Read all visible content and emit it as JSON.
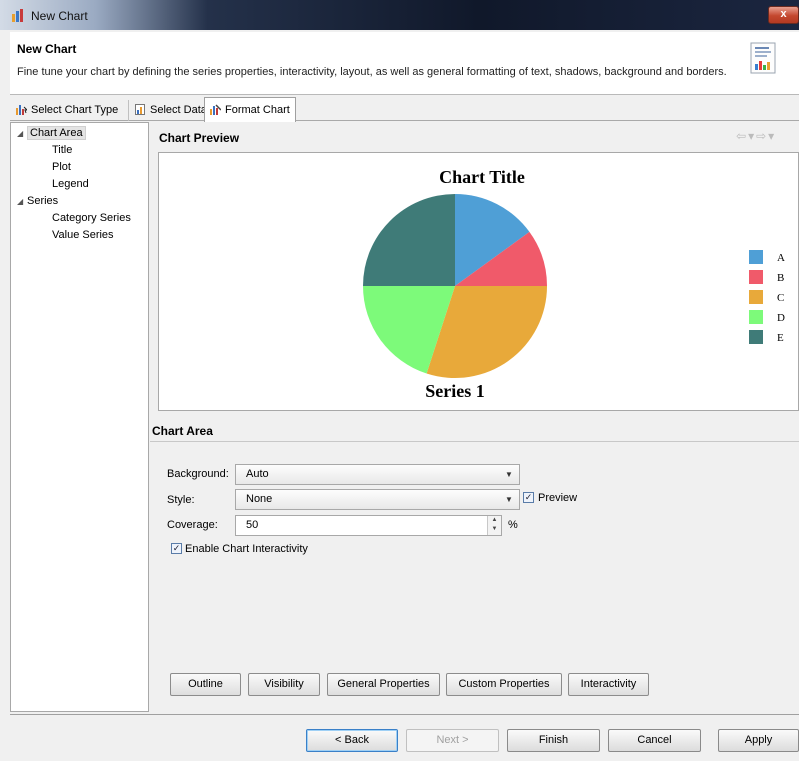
{
  "window": {
    "title": "New Chart",
    "close_label": "x"
  },
  "header": {
    "title": "New Chart",
    "description": "Fine tune your chart by defining the series properties, interactivity, layout, as well as general formatting of text, shadows, background and borders."
  },
  "tabs": [
    {
      "label": "Select Chart Type"
    },
    {
      "label": "Select Data"
    },
    {
      "label": "Format Chart",
      "active": true
    }
  ],
  "tree": {
    "chart_area": "Chart Area",
    "title": "Title",
    "plot": "Plot",
    "legend": "Legend",
    "series": "Series",
    "category_series": "Category Series",
    "value_series": "Value Series"
  },
  "preview": {
    "title": "Chart Preview"
  },
  "chart_data": {
    "type": "pie",
    "title": "Chart Title",
    "xlabel": "Series 1",
    "categories": [
      "A",
      "B",
      "C",
      "D",
      "E"
    ],
    "values": [
      15,
      10,
      30,
      20,
      25
    ],
    "colors": [
      "#4f9fd6",
      "#f05a6a",
      "#e8a93a",
      "#7dfa7a",
      "#3f7b78"
    ],
    "legend_position": "right"
  },
  "chart_area": {
    "title": "Chart Area",
    "background_label": "Background:",
    "background_value": "Auto",
    "style_label": "Style:",
    "style_value": "None",
    "preview_label": "Preview",
    "coverage_label": "Coverage:",
    "coverage_value": "50",
    "coverage_unit": "%",
    "interactivity_label": "Enable Chart Interactivity",
    "preview_checked": true,
    "interactivity_checked": true
  },
  "property_buttons": [
    "Outline",
    "Visibility",
    "General Properties",
    "Custom Properties",
    "Interactivity"
  ],
  "wizard_buttons": {
    "back": "< Back",
    "next": "Next >",
    "finish": "Finish",
    "cancel": "Cancel",
    "apply": "Apply"
  }
}
